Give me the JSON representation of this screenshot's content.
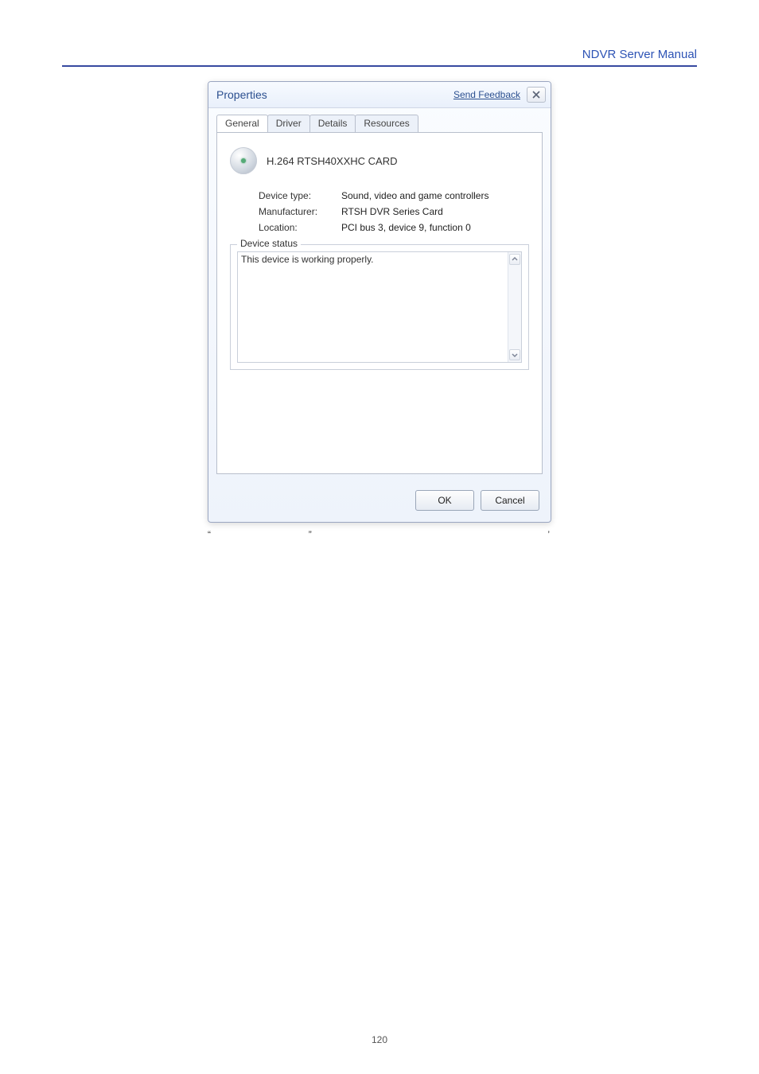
{
  "header": {
    "link": "NDVR Server Manual"
  },
  "dialog": {
    "title": "Properties",
    "send_feedback": "Send Feedback",
    "tabs": [
      "General",
      "Driver",
      "Details",
      "Resources"
    ],
    "active_tab": 0,
    "device_name": "H.264 RTSH40XXHC CARD",
    "rows": {
      "device_type_k": "Device type:",
      "device_type_v": "Sound, video and game controllers",
      "manufacturer_k": "Manufacturer:",
      "manufacturer_v": "RTSH DVR Series Card",
      "location_k": "Location:",
      "location_v": "PCI bus 3, device 9, function 0"
    },
    "status": {
      "legend": "Device status",
      "text": "This device is working properly."
    },
    "buttons": {
      "ok": "OK",
      "cancel": "Cancel"
    }
  },
  "caption": {
    "lq": "“",
    "rq": "”",
    "comma": "’"
  },
  "page_number": "120"
}
